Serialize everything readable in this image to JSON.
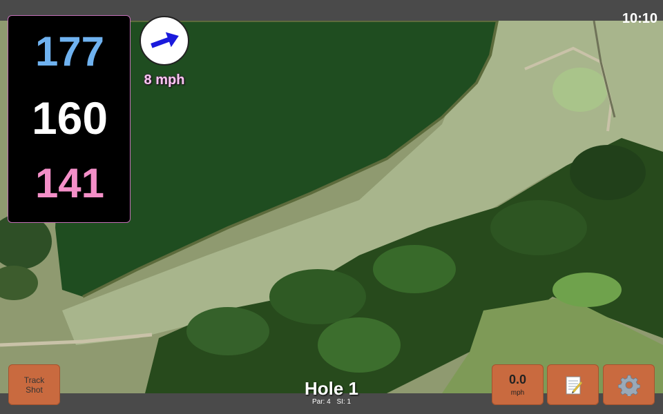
{
  "status_bar": {
    "time": "10:10"
  },
  "yardage": {
    "back": "177",
    "middle": "160",
    "front": "141"
  },
  "wind": {
    "speed": "8 mph",
    "icon": "arrow-icon"
  },
  "buttons": {
    "track_shot": "Track\nShot",
    "speed_value": "0.0",
    "speed_unit": "mph",
    "notes_icon": "notepad-icon",
    "settings_icon": "gear-icon"
  },
  "hole": {
    "title": "Hole 1",
    "par": "Par: 4",
    "si": "SI: 1"
  },
  "colors": {
    "back_yardage": "#6fb2f0",
    "middle_yardage": "#ffffff",
    "front_yardage": "#f48fc8",
    "button": "#c96a3f",
    "wind_text": "#f8c8f0"
  }
}
